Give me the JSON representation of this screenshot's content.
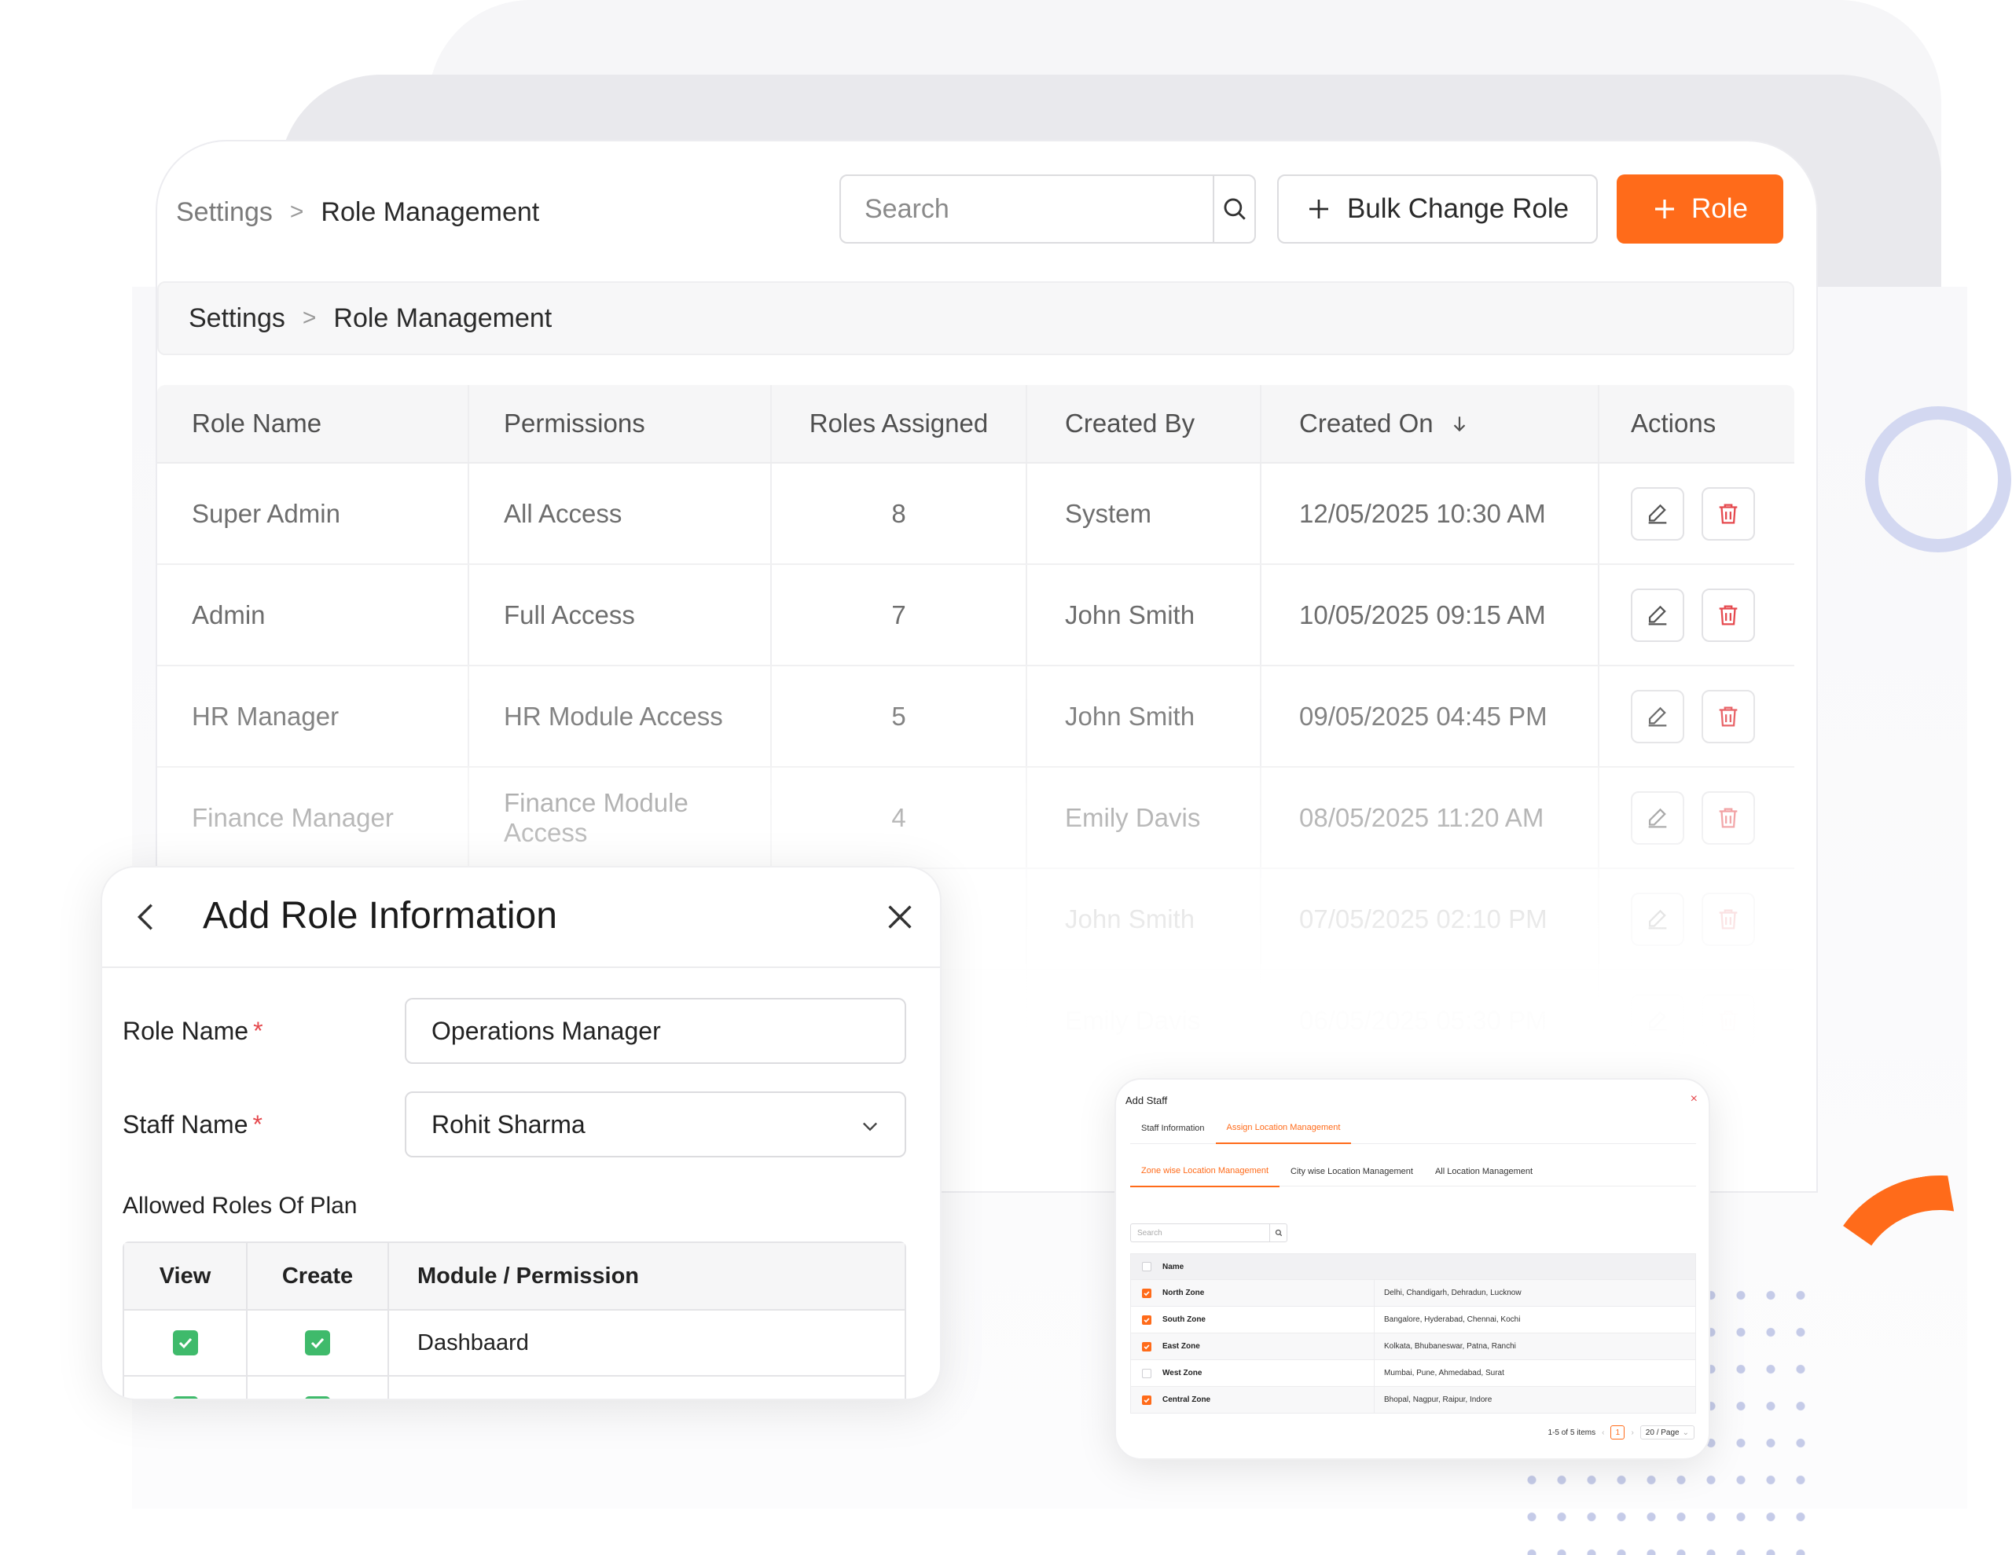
{
  "header": {
    "breadcrumb_root": "Settings",
    "breadcrumb_sep": ">",
    "breadcrumb_current": "Role Management",
    "search_placeholder": "Search",
    "bulk_button": "Bulk Change Role",
    "role_button": "Role"
  },
  "subheader": {
    "breadcrumb_root": "Settings",
    "breadcrumb_sep": ">",
    "breadcrumb_current": "Role Management"
  },
  "table": {
    "columns": [
      "Role Name",
      "Permissions",
      "Roles Assigned",
      "Created By",
      "Created On",
      "Actions"
    ],
    "rows": [
      {
        "role": "Super Admin",
        "permissions": "All Access",
        "assigned": "8",
        "created_by": "System",
        "created_on": "12/05/2025 10:30 AM"
      },
      {
        "role": "Admin",
        "permissions": "Full Access",
        "assigned": "7",
        "created_by": "John Smith",
        "created_on": "10/05/2025 09:15 AM"
      },
      {
        "role": "HR Manager",
        "permissions": "HR Module Access",
        "assigned": "5",
        "created_by": "John Smith",
        "created_on": "09/05/2025 04:45 PM"
      },
      {
        "role": "Finance Manager",
        "permissions": "Finance Module Access",
        "assigned": "4",
        "created_by": "Emily Davis",
        "created_on": "08/05/2025 11:20 AM"
      },
      {
        "role": "",
        "permissions": "",
        "assigned": "",
        "created_by": "John Smith",
        "created_on": "07/05/2025 02:10 PM"
      },
      {
        "role": "",
        "permissions": "",
        "assigned": "",
        "created_by": "Emily Davis",
        "created_on": "06/05/2025 05:30 PM"
      }
    ]
  },
  "modal": {
    "title": "Add Role Information",
    "role_name_label": "Role Name",
    "role_name_value": "Operations Manager",
    "staff_name_label": "Staff Name",
    "staff_name_value": "Rohit Sharma",
    "required_mark": "*",
    "allowed_label": "Allowed Roles Of Plan",
    "perm_columns": [
      "View",
      "Create",
      "Module / Permission"
    ],
    "perm_rows": [
      {
        "module": "Dashbaard"
      }
    ]
  },
  "staff_panel": {
    "title": "Add Staff",
    "close": "×",
    "tabs": [
      "Staff Information",
      "Assign Location Management"
    ],
    "subtabs": [
      "Zone wise Location Management",
      "City wise Location Management",
      "All Location Management"
    ],
    "search_placeholder": "Search",
    "name_header": "Name",
    "rows": [
      {
        "name": "North Zone",
        "cities": "Delhi, Chandigarh, Dehradun, Lucknow",
        "checked": true
      },
      {
        "name": "South Zone",
        "cities": "Bangalore, Hyderabad, Chennai, Kochi",
        "checked": true
      },
      {
        "name": "East Zone",
        "cities": "Kolkata, Bhubaneswar, Patna, Ranchi",
        "checked": true
      },
      {
        "name": "West Zone",
        "cities": "Mumbai, Pune, Ahmedabad, Surat",
        "checked": false
      },
      {
        "name": "Central Zone",
        "cities": "Bhopal, Nagpur, Raipur, Indore",
        "checked": true
      }
    ],
    "pager_summary": "1-5 of 5 items",
    "current_page": "1",
    "page_size": "20 / Page"
  },
  "colors": {
    "accent": "#ff6b1a",
    "success": "#3fba6b",
    "danger": "#e5484d"
  }
}
